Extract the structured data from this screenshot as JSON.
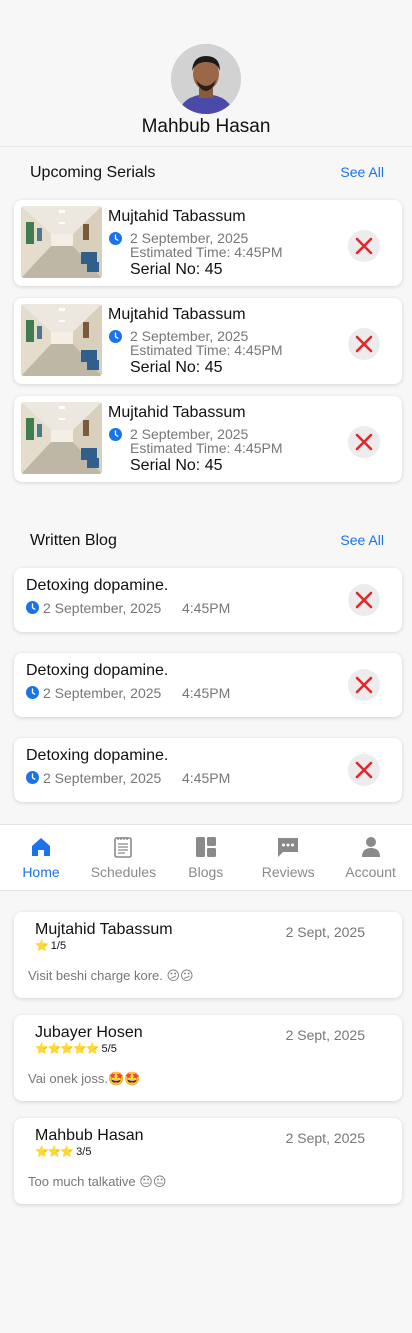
{
  "profile": {
    "name": "Mahbub Hasan"
  },
  "upcoming": {
    "title": "Upcoming Serials",
    "see_all": "See All",
    "items": [
      {
        "name": "Mujtahid Tabassum",
        "date": "2 September, 2025",
        "time": "Estimated Time: 4:45PM",
        "serial": "Serial No: 45"
      },
      {
        "name": "Mujtahid Tabassum",
        "date": "2 September, 2025",
        "time": "Estimated Time: 4:45PM",
        "serial": "Serial No: 45"
      },
      {
        "name": "Mujtahid Tabassum",
        "date": "2 September, 2025",
        "time": "Estimated Time: 4:45PM",
        "serial": "Serial No: 45"
      }
    ]
  },
  "blogs": {
    "title": "Written Blog",
    "see_all": "See All",
    "items": [
      {
        "title": "Detoxing dopamine.",
        "date": "2 September, 2025",
        "time": "4:45PM"
      },
      {
        "title": "Detoxing dopamine.",
        "date": "2 September, 2025",
        "time": "4:45PM"
      },
      {
        "title": "Detoxing dopamine.",
        "date": "2 September, 2025",
        "time": "4:45PM"
      }
    ]
  },
  "nav": {
    "items": [
      {
        "label": "Home",
        "icon": "home-icon",
        "active": true
      },
      {
        "label": "Schedules",
        "icon": "schedule-icon",
        "active": false
      },
      {
        "label": "Blogs",
        "icon": "blogs-icon",
        "active": false
      },
      {
        "label": "Reviews",
        "icon": "reviews-icon",
        "active": false
      },
      {
        "label": "Account",
        "icon": "account-icon",
        "active": false
      }
    ]
  },
  "reviews": {
    "items": [
      {
        "name": "Mujtahid Tabassum",
        "date": "2 Sept, 2025",
        "stars": "⭐",
        "rating": "1/5",
        "comment": "Visit beshi charge kore. 😕😕"
      },
      {
        "name": "Jubayer Hosen",
        "date": "2 Sept, 2025",
        "stars": "⭐⭐⭐⭐⭐",
        "rating": "5/5",
        "comment": "Vai onek joss.🤩🤩"
      },
      {
        "name": "Mahbub Hasan",
        "date": "2 Sept, 2025",
        "stars": "⭐⭐⭐",
        "rating": "3/5",
        "comment": "Too much talkative 😐😐"
      }
    ]
  },
  "colors": {
    "accent": "#1a73e8",
    "danger": "#e5262b",
    "star": "#f4c21a"
  }
}
